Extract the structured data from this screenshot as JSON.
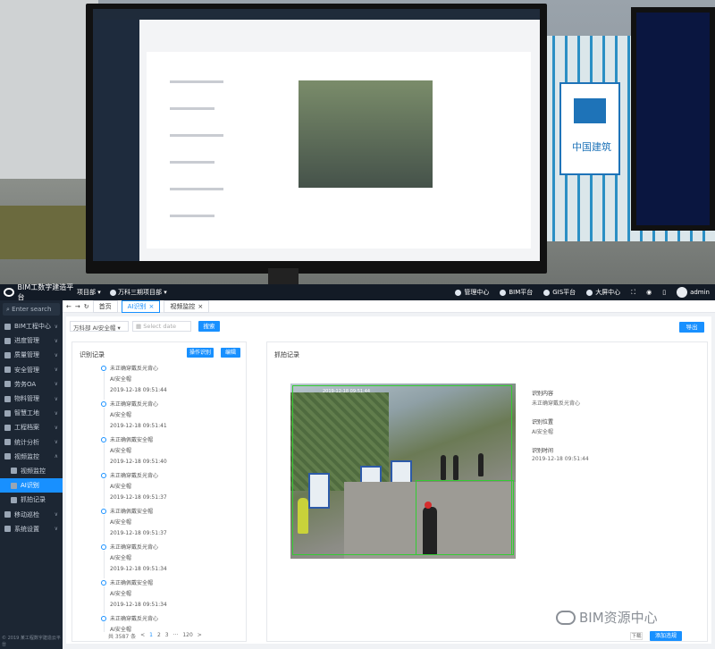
{
  "photo": {
    "sign_text": "中国建筑"
  },
  "topbar": {
    "brand": "BIM工数字建造平台",
    "project": "项目部",
    "project2": "万科三期项目部",
    "right_items": [
      "管理中心",
      "BIM平台",
      "GIS平台",
      "大屏中心"
    ],
    "user": "admin"
  },
  "sidebar": {
    "search_placeholder": "Enter search",
    "items": [
      {
        "label": "BIM工程中心",
        "chev": "∨"
      },
      {
        "label": "进度管理",
        "chev": "∨"
      },
      {
        "label": "质量管理",
        "chev": "∨"
      },
      {
        "label": "安全管理",
        "chev": "∨"
      },
      {
        "label": "劳务OA",
        "chev": "∨"
      },
      {
        "label": "物料管理",
        "chev": "∨"
      },
      {
        "label": "智慧工地",
        "chev": "∨"
      },
      {
        "label": "工程档案",
        "chev": "∨"
      },
      {
        "label": "统计分析",
        "chev": "∨"
      },
      {
        "label": "视频监控",
        "chev": "∧"
      }
    ],
    "sub_items": [
      {
        "label": "视频监控"
      },
      {
        "label": "AI识别"
      },
      {
        "label": "抓拍记录"
      }
    ],
    "after_items": [
      {
        "label": "移动巡检",
        "chev": "∨"
      },
      {
        "label": "系统设置",
        "chev": "∨"
      }
    ],
    "footer": "© 2019 某工程数字建造云平台"
  },
  "tabs": [
    "首页",
    "AI识别",
    "视频监控"
  ],
  "filter": {
    "select_value": "万科部 AI安全帽",
    "date_placeholder": "Select date",
    "search_label": "搜索",
    "export_label": "导出"
  },
  "left_panel": {
    "title": "识别记录",
    "btn_status": "操作识别",
    "btn_edit": "编辑",
    "records": [
      {
        "title": "未正确穿戴反光背心",
        "type": "AI安全帽",
        "time": "2019-12-18 09:51:44"
      },
      {
        "title": "未正确穿戴反光背心",
        "type": "AI安全帽",
        "time": "2019-12-18 09:51:41"
      },
      {
        "title": "未正确佩戴安全帽",
        "type": "AI安全帽",
        "time": "2019-12-18 09:51:40"
      },
      {
        "title": "未正确穿戴反光背心",
        "type": "AI安全帽",
        "time": "2019-12-18 09:51:37"
      },
      {
        "title": "未正确佩戴安全帽",
        "type": "AI安全帽",
        "time": "2019-12-18 09:51:37"
      },
      {
        "title": "未正确穿戴反光背心",
        "type": "AI安全帽",
        "time": "2019-12-18 09:51:34"
      },
      {
        "title": "未正确佩戴安全帽",
        "type": "AI安全帽",
        "time": "2019-12-18 09:51:34"
      },
      {
        "title": "未正确穿戴反光背心",
        "type": "AI安全帽",
        "time": "2019-12-18 09:51:31"
      }
    ],
    "pager": {
      "total": "共 3587 条",
      "p1": "1",
      "p2": "2",
      "p3": "3",
      "ellipsis": "···",
      "last": "120",
      "next": ">",
      "prev": "<"
    }
  },
  "right_panel": {
    "title": "抓拍记录",
    "stamp": "2019-12-18 09:51:44",
    "info": [
      {
        "label": "识别内容",
        "value": "未正确穿戴反光背心"
      },
      {
        "label": "识别位置",
        "value": "AI安全帽"
      },
      {
        "label": "识别时间",
        "value": "2019-12-18 09:51:44"
      }
    ],
    "btn_a": "下载",
    "btn_b": "添加违规"
  },
  "watermark": "BIM资源中心"
}
